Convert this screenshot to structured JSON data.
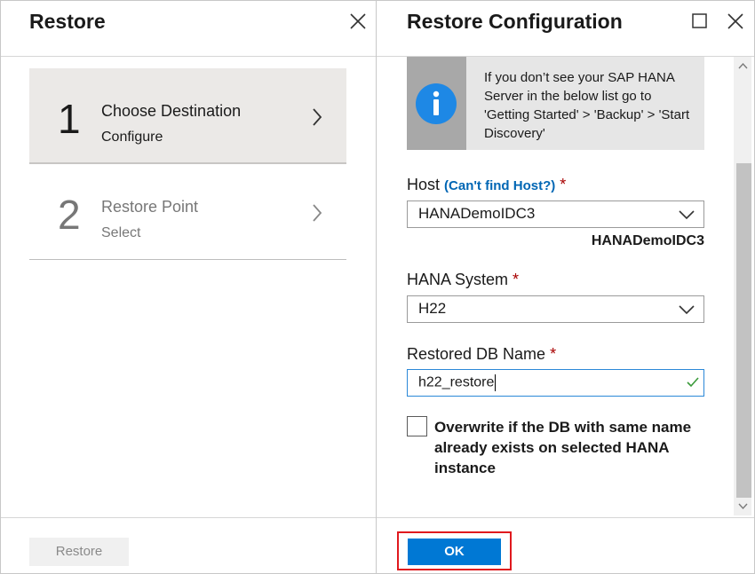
{
  "left_blade": {
    "title": "Restore",
    "steps": [
      {
        "number": "1",
        "label": "Choose Destination",
        "sub": "Configure"
      },
      {
        "number": "2",
        "label": "Restore Point",
        "sub": "Select"
      }
    ],
    "footer_button": "Restore"
  },
  "right_blade": {
    "title": "Restore Configuration",
    "info_text": "If you don’t see your SAP HANA Server in the below list go to 'Getting Started' > 'Backup' > 'Start Discovery'",
    "host": {
      "label": "Host",
      "link_open": "(",
      "link": "Can't find Host?",
      "link_close": ")",
      "required": "*",
      "value": "HANADemoIDC3",
      "caption": "HANADemoIDC3"
    },
    "hana_system": {
      "label": "HANA System",
      "required": "*",
      "value": "H22"
    },
    "restored_db": {
      "label": "Restored DB Name",
      "required": "*",
      "value": "h22_restore"
    },
    "overwrite_label": "Overwrite if the DB with same name already exists on selected HANA instance",
    "ok_button": "OK"
  },
  "icons": [
    "close-icon",
    "maximize-icon",
    "info-icon",
    "chevron-right-icon",
    "chevron-down-icon",
    "check-icon",
    "scroll-up-icon",
    "scroll-down-icon"
  ],
  "colors": {
    "primary": "#0078d4",
    "highlight": "#e0191e",
    "required": "#a80000",
    "link": "#0066b4"
  }
}
